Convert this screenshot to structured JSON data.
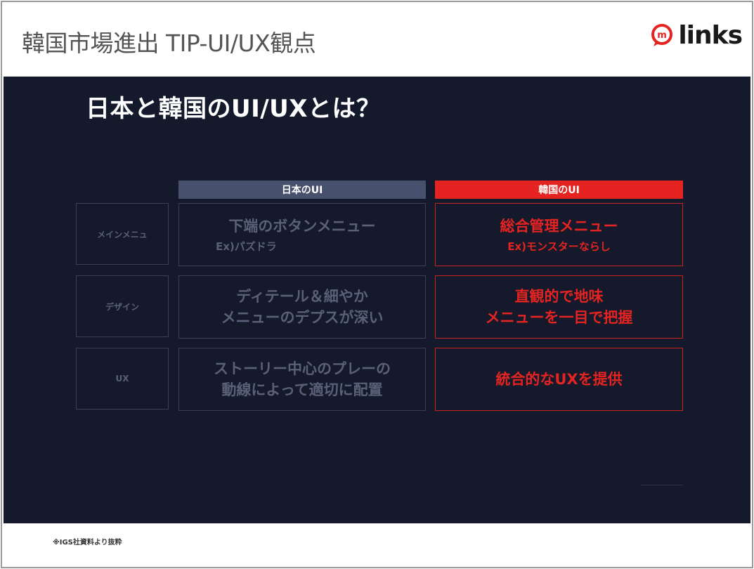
{
  "header": {
    "title": "韓国市場進出 TIP-UI/UX観点",
    "logo_text": "links",
    "logo_icon": "speech-bubble-m-icon",
    "brand_color": "#e52320"
  },
  "slide": {
    "heading": "日本と韓国のUI/UXとは？",
    "columns": {
      "japan": "日本のUI",
      "korea": "韓国のUI"
    },
    "rows": [
      {
        "label": "メインメニュ",
        "japan_main": "下端のボタンメニュー",
        "japan_sub": "Ex)パズドラ",
        "korea_main": "総合管理メニュー",
        "korea_sub": "Ex)モンスターならし"
      },
      {
        "label": "デザイン",
        "japan_main": "ディテール＆細やか\nメニューのデプスが深い",
        "korea_main": "直観的で地味\nメニューを一目で把握"
      },
      {
        "label": "UX",
        "japan_main": "ストーリー中心のプレーの\n動線によって適切に配置",
        "korea_main": "統合的なUXを提供"
      }
    ]
  },
  "footer": {
    "note": "※IGS社資料より抜粋"
  }
}
